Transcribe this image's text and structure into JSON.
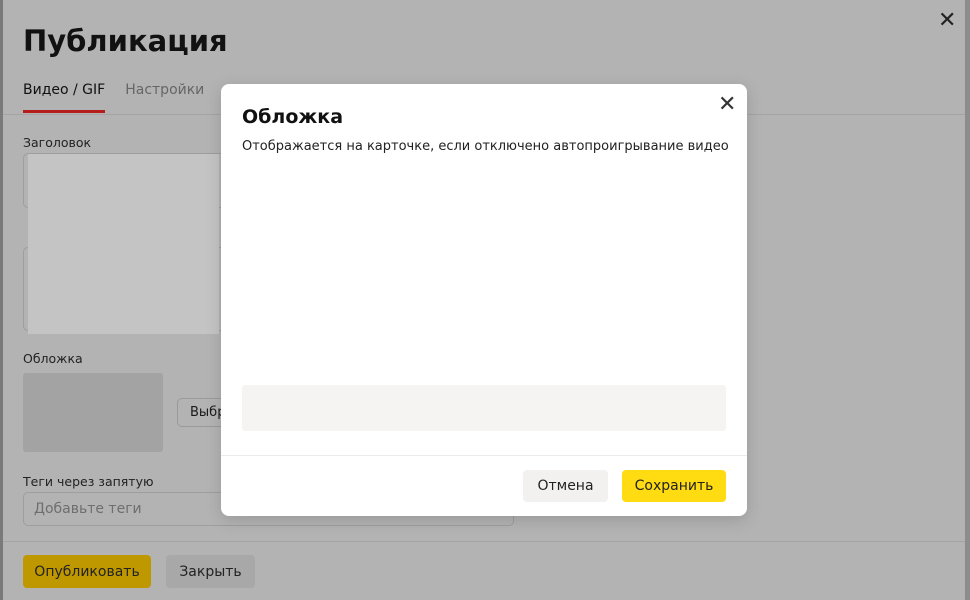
{
  "main": {
    "title": "Публикация",
    "tabs": [
      {
        "label": "Видео / GIF",
        "active": true
      },
      {
        "label": "Настройки",
        "active": false
      }
    ],
    "fields": {
      "headline_label": "Заголовок",
      "cover_label": "Обложка",
      "choose_button": "Выбр",
      "tags_label": "Теги через запятую",
      "tags_placeholder": "Добавьте теги"
    },
    "buttons": {
      "publish": "Опубликовать",
      "close": "Закрыть"
    }
  },
  "modal": {
    "title": "Обложка",
    "subtitle": "Отображается на карточке, если отключено автопроигрывание видео",
    "cancel": "Отмена",
    "save": "Сохранить"
  },
  "colors": {
    "accent": "#ffdb11",
    "tab_underline": "#b51c1c"
  }
}
